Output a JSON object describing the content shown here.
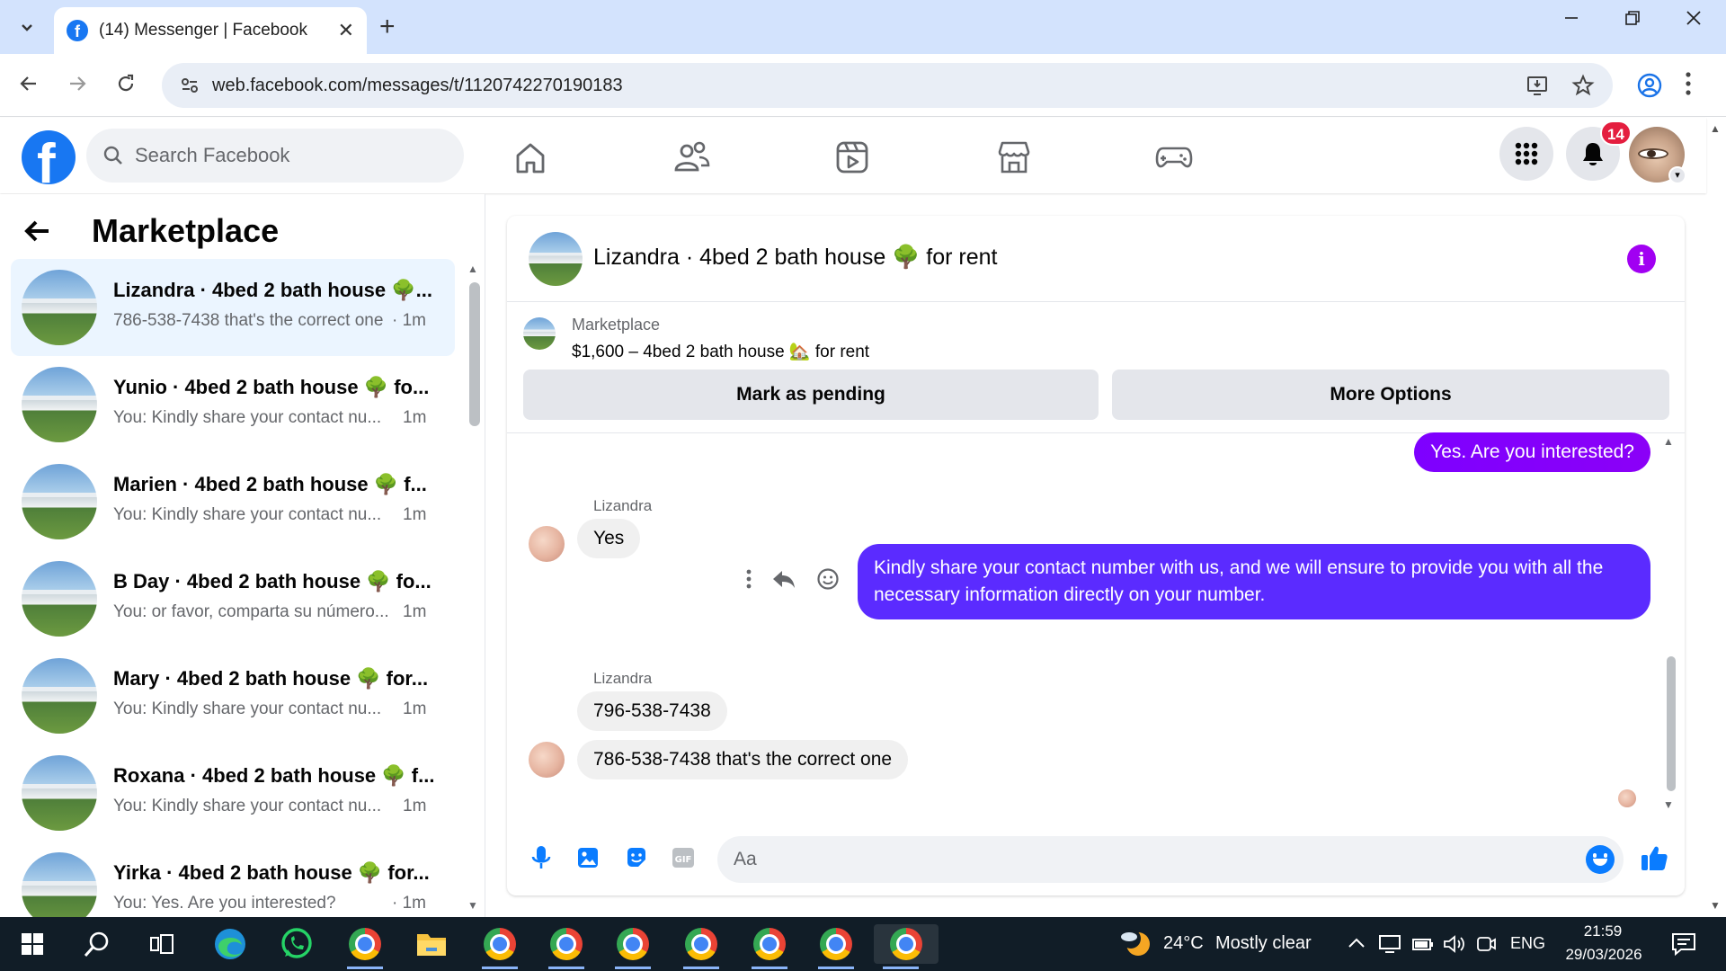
{
  "browser": {
    "tab_title": "(14) Messenger | Facebook",
    "url": "web.facebook.com/messages/t/1120742270190183",
    "new_tab": "+",
    "tab_close": "✕"
  },
  "fb": {
    "search_placeholder": "Search Facebook",
    "notification_count": "14",
    "logo_letter": "f"
  },
  "sidebar": {
    "title": "Marketplace",
    "conversations": [
      {
        "name": "Lizandra · 4bed 2 bath house 🌳...",
        "snippet": "786-538-7438 that's the correct one",
        "time": "· 1m",
        "active": true
      },
      {
        "name": "Yunio · 4bed 2 bath house 🌳 fo...",
        "snippet": "You: Kindly share your contact nu...",
        "time": "1m"
      },
      {
        "name": "Marien · 4bed 2 bath house 🌳 f...",
        "snippet": "You: Kindly share your contact nu...",
        "time": "1m"
      },
      {
        "name": "B Day · 4bed 2 bath house 🌳 fo...",
        "snippet": "You: or favor, comparta su número...",
        "time": "1m"
      },
      {
        "name": "Mary · 4bed 2 bath house 🌳 for...",
        "snippet": "You: Kindly share your contact nu...",
        "time": "1m"
      },
      {
        "name": "Roxana · 4bed 2 bath house 🌳 f...",
        "snippet": "You: Kindly share your contact nu...",
        "time": "1m"
      },
      {
        "name": "Yirka · 4bed 2 bath house 🌳 for...",
        "snippet": "You: Yes. Are you interested?",
        "time": "· 1m"
      }
    ]
  },
  "chat": {
    "title": "Lizandra · 4bed 2 bath house 🌳 for rent",
    "marketplace_label": "Marketplace",
    "listing": "$1,600 – 4bed 2 bath house 🏡 for rent",
    "mark_pending": "Mark as pending",
    "more_options": "More Options",
    "messages": {
      "out1": "Yes. Are you interested?",
      "sender1": "Lizandra",
      "in1": "Yes",
      "out2": "Kindly share your contact number with us, and we will ensure to provide you with all the necessary information directly on your number.",
      "sender2": "Lizandra",
      "in2": "796-538-7438",
      "in3": "786-538-7438 that's the correct one"
    },
    "composer_placeholder": "Aa"
  },
  "taskbar": {
    "weather_temp": "24°C",
    "weather_desc": "Mostly clear",
    "language": "ENG",
    "time": "21:59",
    "date": "29/03/2026"
  },
  "colors": {
    "fb_blue": "#1877f2",
    "messenger_purple": "#8a00ff",
    "notification_red": "#e41e3f",
    "active_conversation": "#ebf5ff"
  }
}
